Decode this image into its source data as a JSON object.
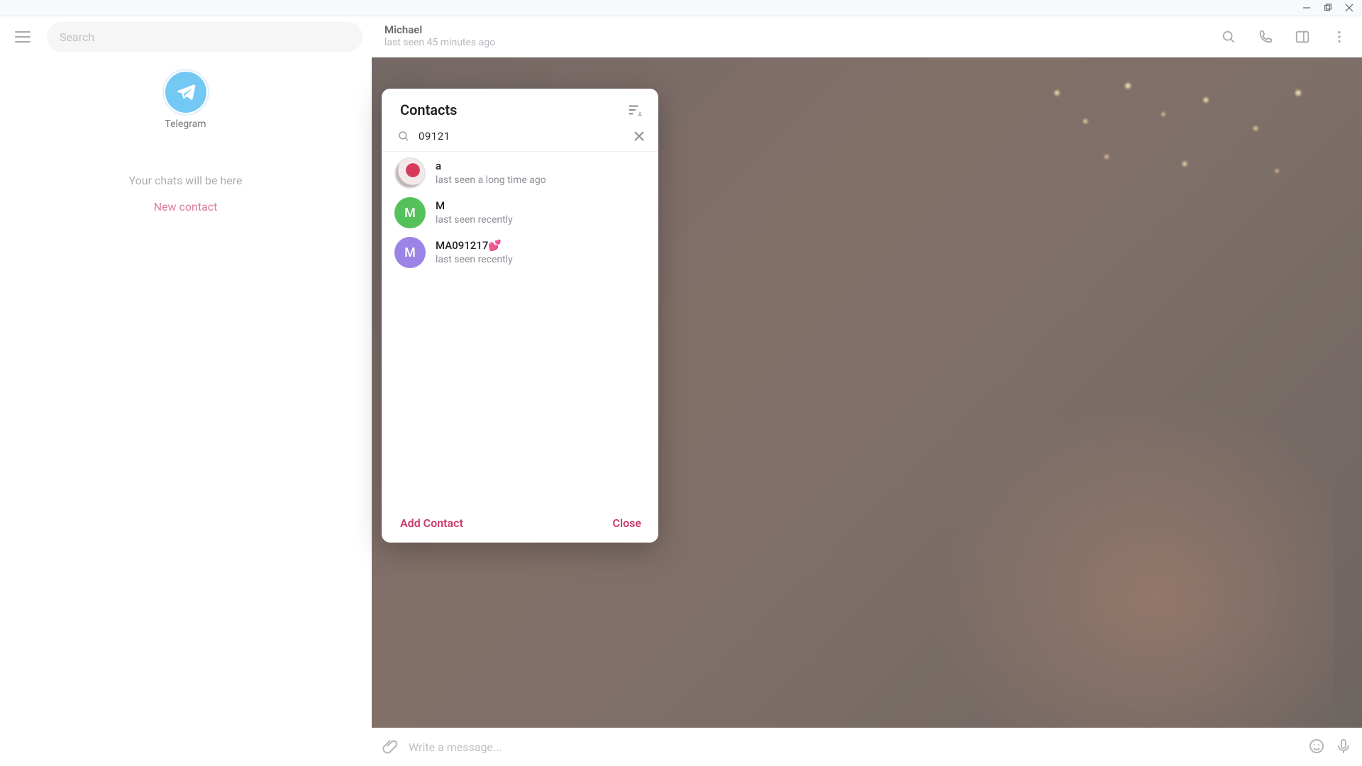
{
  "window": {
    "controls": {
      "minimize": "–",
      "maximize": "❐",
      "close": "×"
    }
  },
  "sidebar": {
    "search_placeholder": "Search",
    "logo_label": "Telegram",
    "empty_hint": "Your chats will be here",
    "new_contact_label": "New contact"
  },
  "chat": {
    "title": "Michael",
    "status": "last seen 45 minutes ago",
    "input_placeholder": "Write a message..."
  },
  "modal": {
    "title": "Contacts",
    "search_value": "09121",
    "add_contact_label": "Add Contact",
    "close_label": "Close",
    "contacts": [
      {
        "name": "a",
        "status": "last seen a long time ago",
        "avatar_kind": "image",
        "avatar_letter": "",
        "avatar_bg": "#ffffff"
      },
      {
        "name": "M",
        "status": "last seen recently",
        "avatar_kind": "letter",
        "avatar_letter": "M",
        "avatar_bg": "#55c15b"
      },
      {
        "name": "MA091217💕",
        "status": "last seen recently",
        "avatar_kind": "letter",
        "avatar_letter": "M",
        "avatar_bg": "#9b84e5"
      }
    ]
  },
  "colors": {
    "accent": "#ca3b6c",
    "telegram_blue": "#2aabee"
  }
}
